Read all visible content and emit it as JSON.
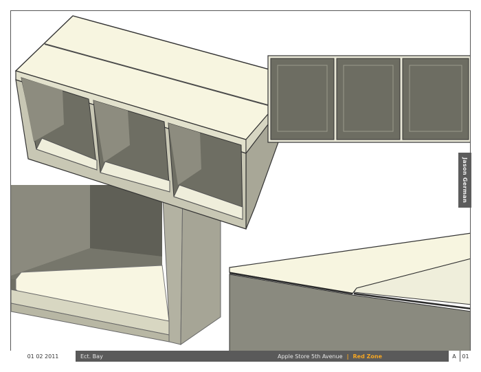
{
  "sheet": {
    "side_label": "Jason German"
  },
  "footer": {
    "date": "01 02 2011",
    "author": "Ect. Bay",
    "location": "Apple Store 5th Avenue",
    "separator": "|",
    "zone": "Red Zone",
    "revision": "A",
    "sheet_number": "01"
  },
  "colors": {
    "panel_cream": "#f7f5e0",
    "panel_grey": "#a3a293",
    "interior_dark": "#6b6b60",
    "footer_bg": "#5a5a5a",
    "accent": "#f5a623"
  }
}
